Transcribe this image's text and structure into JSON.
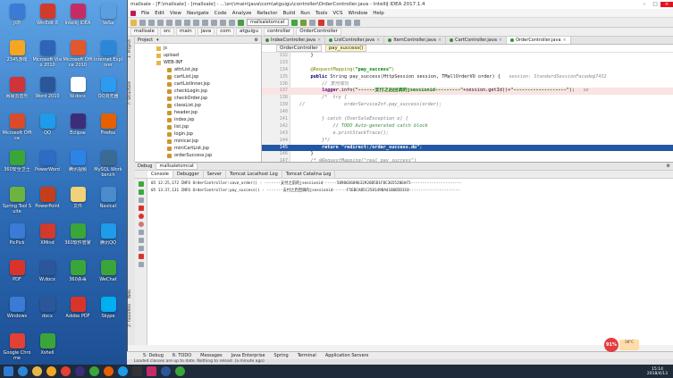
{
  "desktop": {
    "icons": [
      {
        "label": "Ji浏",
        "color": "#3b7bd6"
      },
      {
        "label": "WinEdit 8",
        "color": "#d23a2c"
      },
      {
        "label": "IntelliJ IDEA",
        "color": "#c52c67"
      },
      {
        "label": "VeSa",
        "color": "#5aa0e0"
      },
      {
        "label": "2345游戏",
        "color": "#f6a623"
      },
      {
        "label": "Microsoft Visio 2010",
        "color": "#2f64b7"
      },
      {
        "label": "Microsoft Office 2010",
        "color": "#e2572b"
      },
      {
        "label": "Internet Explorer",
        "color": "#2b88d8"
      },
      {
        "label": "网易云音乐",
        "color": "#d0333a"
      },
      {
        "label": "Word 2010",
        "color": "#2b579a"
      },
      {
        "label": "W.docx",
        "color": "#ffffff"
      },
      {
        "label": "QQ浏览器",
        "color": "#2d9bf0"
      },
      {
        "label": "Microsoft Office",
        "color": "#d94b2a"
      },
      {
        "label": "QQ",
        "color": "#1e9be9"
      },
      {
        "label": "Eclipse",
        "color": "#3c2d7a"
      },
      {
        "label": "Firefox",
        "color": "#e66000"
      },
      {
        "label": "360安全卫士",
        "color": "#3aa63a"
      },
      {
        "label": "PowerWord",
        "color": "#2c6cc4"
      },
      {
        "label": "腾讯视频",
        "color": "#2e84e6"
      },
      {
        "label": "MySQL Workbench",
        "color": "#3a6b94"
      },
      {
        "label": "Spring Tool Suite",
        "color": "#6db33f"
      },
      {
        "label": "PowerPoint",
        "color": "#c43e1c"
      },
      {
        "label": "文件",
        "color": "#f0d27a"
      },
      {
        "label": "Navicat",
        "color": "#4a8ccc"
      },
      {
        "label": "PicPick",
        "color": "#3b7bd6"
      },
      {
        "label": "XMind",
        "color": "#d23a2c"
      },
      {
        "label": "360软件管家",
        "color": "#3aa63a"
      },
      {
        "label": "腾讯QQ",
        "color": "#1e9be9"
      },
      {
        "label": "PDF",
        "color": "#d9342b"
      },
      {
        "label": "W.docx",
        "color": "#2b579a"
      },
      {
        "label": "360杀毒",
        "color": "#3aa63a"
      },
      {
        "label": "WeChat",
        "color": "#3aa63a"
      },
      {
        "label": "Windows",
        "color": "#3b7bd6"
      },
      {
        "label": "docx",
        "color": "#2b579a"
      },
      {
        "label": "Adobe PDF",
        "color": "#d9342b"
      },
      {
        "label": "Skype",
        "color": "#00aff0"
      },
      {
        "label": "Google Chrome",
        "color": "#e34133"
      },
      {
        "label": "Xshell",
        "color": "#3aa63a"
      }
    ]
  },
  "ide": {
    "title": "mallsale - [F:\\mallsale] - [mallsale] - ...\\src\\main\\java\\com\\atguigu\\controller\\OrderController.java - IntelliJ IDEA 2017.1.4",
    "menu": [
      "File",
      "Edit",
      "View",
      "Navigate",
      "Code",
      "Analyze",
      "Refactor",
      "Build",
      "Run",
      "Tools",
      "VCS",
      "Window",
      "Help"
    ],
    "run_config": "mallsaletomcat",
    "nav_crumbs": [
      "mallsale",
      "src",
      "main",
      "java",
      "com",
      "atguigu",
      "controller",
      "OrderController"
    ],
    "project_panel_title": "Project",
    "project_tree": [
      {
        "label": "js",
        "kind": "folder",
        "depth": 2
      },
      {
        "label": "upload",
        "kind": "folder",
        "depth": 2
      },
      {
        "label": "WEB-INF",
        "kind": "folder",
        "depth": 2
      },
      {
        "label": "attrList.jsp",
        "kind": "jsp",
        "depth": 3
      },
      {
        "label": "cartList.jsp",
        "kind": "jsp",
        "depth": 3
      },
      {
        "label": "cartListInner.jsp",
        "kind": "jsp",
        "depth": 3
      },
      {
        "label": "checkLogin.jsp",
        "kind": "jsp",
        "depth": 3
      },
      {
        "label": "checkOrder.jsp",
        "kind": "jsp",
        "depth": 3
      },
      {
        "label": "classList.jsp",
        "kind": "jsp",
        "depth": 3
      },
      {
        "label": "header.jsp",
        "kind": "jsp",
        "depth": 3
      },
      {
        "label": "index.jsp",
        "kind": "jsp",
        "depth": 3
      },
      {
        "label": "list.jsp",
        "kind": "jsp",
        "depth": 3
      },
      {
        "label": "login.jsp",
        "kind": "jsp",
        "depth": 3
      },
      {
        "label": "minicar.jsp",
        "kind": "jsp",
        "depth": 3
      },
      {
        "label": "miniCartList.jsp",
        "kind": "jsp",
        "depth": 3
      },
      {
        "label": "orderSuccess.jsp",
        "kind": "jsp",
        "depth": 3
      }
    ],
    "editor_tabs": [
      "IndexController.java",
      "ListController.java",
      "ItemController.java",
      "CartController.java",
      "OrderController.java"
    ],
    "active_tab": 4,
    "breadcrumb": {
      "class_name": "OrderController",
      "method": "pay_success()"
    },
    "code_lines": [
      {
        "num": "132",
        "tokens": [
          [
            "plain",
            "    }"
          ]
        ]
      },
      {
        "num": "133",
        "tokens": [
          [
            "plain",
            ""
          ]
        ]
      },
      {
        "num": "134",
        "tokens": [
          [
            "an",
            "    @RequestMapping("
          ],
          [
            "st",
            "\"pay_success\""
          ],
          [
            "an",
            ")"
          ]
        ]
      },
      {
        "num": "135",
        "tokens": [
          [
            "kw",
            "    public "
          ],
          [
            "plain",
            "String "
          ],
          [
            "plain",
            "pay_success(HttpSession session, TMallOrderVO order) {   "
          ],
          [
            "hint",
            "session: StandardSessionFacade@7432"
          ]
        ]
      },
      {
        "num": "136",
        "tokens": [
          [
            "cm",
            "        // 支付成功"
          ]
        ]
      },
      {
        "num": "137",
        "tokens": [
          [
            "fld",
            "        logger"
          ],
          [
            "plain",
            ".info("
          ],
          [
            "st",
            "\"------支付之后回调的jsessionid---------\""
          ],
          [
            "plain",
            "+session.getId()+"
          ],
          [
            "st",
            "\"-------------------\""
          ],
          [
            "plain",
            ");   "
          ],
          [
            "hint",
            "se"
          ]
        ]
      },
      {
        "num": "138",
        "tokens": [
          [
            "cm",
            "        /*  try {"
          ]
        ]
      },
      {
        "num": "139",
        "tokens": [
          [
            "cm",
            "//              orderServiceInf.pay_success(order);"
          ]
        ]
      },
      {
        "num": "140",
        "tokens": [
          [
            "plain",
            ""
          ]
        ]
      },
      {
        "num": "141",
        "tokens": [
          [
            "cm",
            "        } catch (OverSaleException e) {"
          ]
        ]
      },
      {
        "num": "142",
        "tokens": [
          [
            "cmg",
            "            // TODO Auto-generated catch block"
          ]
        ]
      },
      {
        "num": "143",
        "tokens": [
          [
            "cm",
            "            e.printStackTrace();"
          ]
        ]
      },
      {
        "num": "144",
        "tokens": [
          [
            "cm",
            "        }*/"
          ]
        ]
      },
      {
        "num": "145",
        "tokens": [
          [
            "kw",
            "        return "
          ],
          [
            "st",
            "\"redirect:/order_success.do\""
          ],
          [
            "plain",
            ";"
          ]
        ]
      },
      {
        "num": "146",
        "tokens": [
          [
            "plain",
            "    }"
          ]
        ]
      },
      {
        "num": "147",
        "tokens": [
          [
            "cm",
            "    /* @RequestMapping(\"real_pay_success\")"
          ]
        ]
      }
    ],
    "breakpoint_line": 5,
    "selected_line": 13,
    "debug": {
      "title": "Debug",
      "session": "mallsaletomcat",
      "tabs": [
        "Console",
        "Debugger",
        "Server",
        "Tomcat Localhost Log",
        "Tomcat Catalina Log"
      ],
      "active_tab": 0,
      "console_lines": [
        "05 12:25,172  INFO  OrderController:save_order() - -------支付之前的jsessionid------589803689632926B5D1F8C3655206AF5----------------------",
        "05 13:37,131  INFO  OrderController:pay_success() - -------支付之后回调的jsessionid------F5EBCAB5C258149BA4186B5D3C0----------------------"
      ]
    },
    "bottom_tabs": [
      "5: Debug",
      "6: TODO",
      "Messages",
      "Java Enterprise",
      "Spring",
      "Terminal",
      "Application Servers"
    ],
    "status_text": "Loaded classes are up to date. Nothing to reload. (a minute ago)",
    "left_tool_tabs": [
      "1: Project",
      "7: Structure"
    ],
    "left_debug_tabs": [
      "Web",
      "2: Favorites"
    ]
  },
  "system": {
    "widget_percent": "91%",
    "widget_temp": "38°C",
    "clock_time": "15:14",
    "clock_date": "2018/4/13"
  }
}
